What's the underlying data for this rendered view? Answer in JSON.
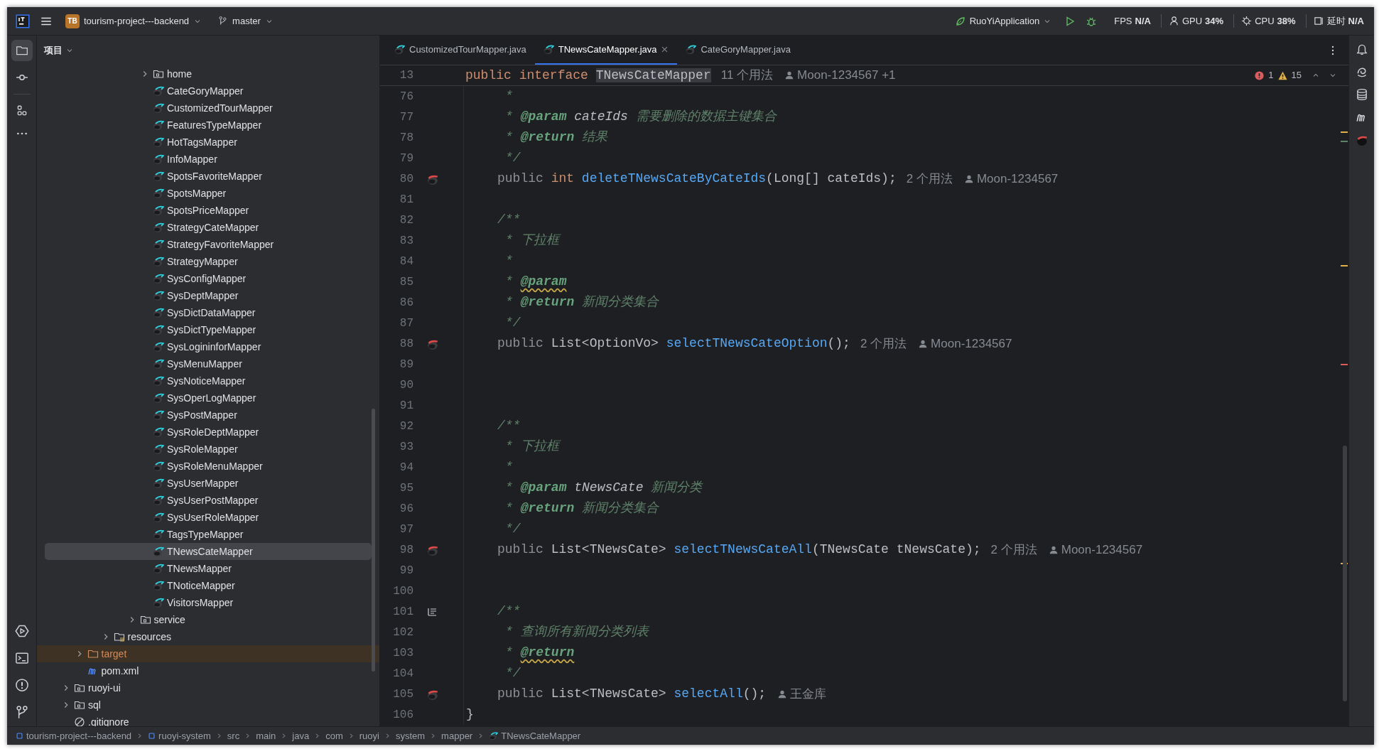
{
  "title_bar": {
    "project_badge": "TB",
    "project": "tourism-project---backend",
    "branch": "master",
    "run_config": "RuoYiApplication",
    "metrics": [
      {
        "kind": "fps",
        "label": "FPS",
        "value": "N/A"
      },
      {
        "kind": "gpu",
        "label": "GPU",
        "value": "34%"
      },
      {
        "kind": "cpu",
        "label": "CPU",
        "value": "38%"
      },
      {
        "kind": "latency",
        "label": "延时",
        "value": "N/A"
      }
    ]
  },
  "project_panel": {
    "title": "项目",
    "tree": [
      {
        "children": [
          {
            "children": [
              {
                "children": [
                  {
                    "children": [
                      {
                        "children": [
                          {
                            "children": [
                              {
                                "label": "home",
                                "kind": "folder",
                                "expanded": false,
                                "selected": false
                              },
                              {
                                "label": "CateGoryMapper",
                                "kind": "mapper",
                                "selected": false
                              },
                              {
                                "label": "CustomizedTourMapper",
                                "kind": "mapper",
                                "selected": false
                              },
                              {
                                "label": "FeaturesTypeMapper",
                                "kind": "mapper",
                                "selected": false
                              },
                              {
                                "label": "HotTagsMapper",
                                "kind": "mapper",
                                "selected": false
                              },
                              {
                                "label": "InfoMapper",
                                "kind": "mapper",
                                "selected": false
                              },
                              {
                                "label": "SpotsFavoriteMapper",
                                "kind": "mapper",
                                "selected": false
                              },
                              {
                                "label": "SpotsMapper",
                                "kind": "mapper",
                                "selected": false
                              },
                              {
                                "label": "SpotsPriceMapper",
                                "kind": "mapper",
                                "selected": false
                              },
                              {
                                "label": "StrategyCateMapper",
                                "kind": "mapper",
                                "selected": false
                              },
                              {
                                "label": "StrategyFavoriteMapper",
                                "kind": "mapper",
                                "selected": false
                              },
                              {
                                "label": "StrategyMapper",
                                "kind": "mapper",
                                "selected": false
                              },
                              {
                                "label": "SysConfigMapper",
                                "kind": "mapper",
                                "selected": false
                              },
                              {
                                "label": "SysDeptMapper",
                                "kind": "mapper",
                                "selected": false
                              },
                              {
                                "label": "SysDictDataMapper",
                                "kind": "mapper",
                                "selected": false
                              },
                              {
                                "label": "SysDictTypeMapper",
                                "kind": "mapper",
                                "selected": false
                              },
                              {
                                "label": "SysLogininforMapper",
                                "kind": "mapper",
                                "selected": false
                              },
                              {
                                "label": "SysMenuMapper",
                                "kind": "mapper",
                                "selected": false
                              },
                              {
                                "label": "SysNoticeMapper",
                                "kind": "mapper",
                                "selected": false
                              },
                              {
                                "label": "SysOperLogMapper",
                                "kind": "mapper",
                                "selected": false
                              },
                              {
                                "label": "SysPostMapper",
                                "kind": "mapper",
                                "selected": false
                              },
                              {
                                "label": "SysRoleDeptMapper",
                                "kind": "mapper",
                                "selected": false
                              },
                              {
                                "label": "SysRoleMapper",
                                "kind": "mapper",
                                "selected": false
                              },
                              {
                                "label": "SysRoleMenuMapper",
                                "kind": "mapper",
                                "selected": false
                              },
                              {
                                "label": "SysUserMapper",
                                "kind": "mapper",
                                "selected": false
                              },
                              {
                                "label": "SysUserPostMapper",
                                "kind": "mapper",
                                "selected": false
                              },
                              {
                                "label": "SysUserRoleMapper",
                                "kind": "mapper",
                                "selected": false
                              },
                              {
                                "label": "TagsTypeMapper",
                                "kind": "mapper",
                                "selected": false
                              },
                              {
                                "label": "TNewsCateMapper",
                                "kind": "mapper",
                                "selected": true
                              },
                              {
                                "label": "TNewsMapper",
                                "kind": "mapper",
                                "selected": false
                              },
                              {
                                "label": "TNoticeMapper",
                                "kind": "mapper",
                                "selected": false
                              },
                              {
                                "label": "VisitorsMapper",
                                "kind": "mapper",
                                "selected": false
                              }
                            ]
                          },
                          {
                            "label": "service",
                            "kind": "folder",
                            "expanded": false,
                            "selected": false
                          }
                        ]
                      }
                    ]
                  },
                  {
                    "label": "resources",
                    "kind": "resources",
                    "expanded": false,
                    "selected": false
                  }
                ]
              }
            ]
          },
          {
            "label": "target",
            "kind": "excluded",
            "expanded": false,
            "selected": false
          },
          {
            "label": "pom.xml",
            "kind": "maven",
            "selected": false
          }
        ]
      },
      {
        "label": "ruoyi-ui",
        "kind": "folder",
        "expanded": false,
        "selected": false
      },
      {
        "label": "sql",
        "kind": "folder",
        "expanded": false,
        "selected": false
      },
      {
        "label": ".gitignore",
        "kind": "ignore",
        "selected": false
      }
    ]
  },
  "editor": {
    "tabs": [
      {
        "label": "CustomizedTourMapper.java",
        "selected": false
      },
      {
        "label": "TNewsCateMapper.java",
        "selected": true
      },
      {
        "label": "CateGoryMapper.java",
        "selected": false
      }
    ],
    "problems": {
      "errors": "1",
      "warnings": "15"
    },
    "sticky_line": {
      "number": "13",
      "tokens": [
        {
          "kind": "keyword",
          "text": "public"
        },
        {
          "kind": "keyword",
          "text": "interface"
        },
        {
          "kind": "highlight",
          "text": "TNewsCateMapper"
        }
      ],
      "usages": "11 个用法",
      "author": "Moon-1234567 +1"
    },
    "lines": [
      {
        "number": "76",
        "kind": "doc",
        "tokens": [
          {
            "kind": "doc",
            "text": "*"
          }
        ]
      },
      {
        "number": "77",
        "kind": "doc",
        "tokens": [
          {
            "kind": "doc",
            "text": "*"
          },
          {
            "kind": "tag",
            "text": "@param",
            "warning": false
          },
          {
            "kind": "docparam",
            "text": "cateIds"
          },
          {
            "kind": "doc",
            "text": "需要删除的数据主键集合"
          }
        ]
      },
      {
        "number": "78",
        "kind": "doc",
        "tokens": [
          {
            "kind": "doc",
            "text": "*"
          },
          {
            "kind": "tag",
            "text": "@return",
            "warning": false
          },
          {
            "kind": "doc",
            "text": "结果"
          }
        ]
      },
      {
        "number": "79",
        "kind": "doc",
        "tokens": [
          {
            "kind": "doc",
            "text": "*/"
          }
        ]
      },
      {
        "number": "80",
        "kind": "member",
        "gutter_icon": {
          "kind": "mapper"
        },
        "tokens": [
          {
            "kind": "modifier",
            "text": "public"
          },
          {
            "kind": "keyword",
            "text": "int"
          },
          {
            "kind": "method",
            "text": "deleteTNewsCateByCateIds"
          },
          {
            "kind": "plain",
            "text": "(Long[] cateIds);",
            "glue": true
          }
        ],
        "usages": "2 个用法",
        "author": "Moon-1234567"
      },
      {
        "number": "81",
        "kind": "blank"
      },
      {
        "number": "82",
        "kind": "member",
        "tokens": [
          {
            "kind": "doc",
            "text": "/**"
          }
        ]
      },
      {
        "number": "83",
        "kind": "doc",
        "tokens": [
          {
            "kind": "doc",
            "text": "*"
          },
          {
            "kind": "doc",
            "text": "下拉框"
          }
        ]
      },
      {
        "number": "84",
        "kind": "doc",
        "tokens": [
          {
            "kind": "doc",
            "text": "*"
          }
        ]
      },
      {
        "number": "85",
        "kind": "doc",
        "tokens": [
          {
            "kind": "doc",
            "text": "*"
          },
          {
            "kind": "tag",
            "text": "@param",
            "warning": true
          }
        ]
      },
      {
        "number": "86",
        "kind": "doc",
        "tokens": [
          {
            "kind": "doc",
            "text": "*"
          },
          {
            "kind": "tag",
            "text": "@return",
            "warning": false
          },
          {
            "kind": "doc",
            "text": "新闻分类集合"
          }
        ]
      },
      {
        "number": "87",
        "kind": "doc",
        "tokens": [
          {
            "kind": "doc",
            "text": "*/"
          }
        ]
      },
      {
        "number": "88",
        "kind": "member",
        "gutter_icon": {
          "kind": "mapper"
        },
        "tokens": [
          {
            "kind": "modifier",
            "text": "public"
          },
          {
            "kind": "plain",
            "text": "List<OptionVo>"
          },
          {
            "kind": "method",
            "text": "selectTNewsCateOption"
          },
          {
            "kind": "plain",
            "text": "();",
            "glue": true
          }
        ],
        "usages": "2 个用法",
        "author": "Moon-1234567"
      },
      {
        "number": "89",
        "kind": "blank"
      },
      {
        "number": "90",
        "kind": "blank"
      },
      {
        "number": "91",
        "kind": "blank"
      },
      {
        "number": "92",
        "kind": "member",
        "tokens": [
          {
            "kind": "doc",
            "text": "/**"
          }
        ]
      },
      {
        "number": "93",
        "kind": "doc",
        "tokens": [
          {
            "kind": "doc",
            "text": "*"
          },
          {
            "kind": "doc",
            "text": "下拉框"
          }
        ]
      },
      {
        "number": "94",
        "kind": "doc",
        "tokens": [
          {
            "kind": "doc",
            "text": "*"
          }
        ]
      },
      {
        "number": "95",
        "kind": "doc",
        "tokens": [
          {
            "kind": "doc",
            "text": "*"
          },
          {
            "kind": "tag",
            "text": "@param",
            "warning": false
          },
          {
            "kind": "docparam",
            "text": "tNewsCate"
          },
          {
            "kind": "doc",
            "text": "新闻分类"
          }
        ]
      },
      {
        "number": "96",
        "kind": "doc",
        "tokens": [
          {
            "kind": "doc",
            "text": "*"
          },
          {
            "kind": "tag",
            "text": "@return",
            "warning": false
          },
          {
            "kind": "doc",
            "text": "新闻分类集合"
          }
        ]
      },
      {
        "number": "97",
        "kind": "doc",
        "tokens": [
          {
            "kind": "doc",
            "text": "*/"
          }
        ]
      },
      {
        "number": "98",
        "kind": "member",
        "gutter_icon": {
          "kind": "mapper"
        },
        "tokens": [
          {
            "kind": "modifier",
            "text": "public"
          },
          {
            "kind": "plain",
            "text": "List<TNewsCate>"
          },
          {
            "kind": "method",
            "text": "selectTNewsCateAll"
          },
          {
            "kind": "plain",
            "text": "(TNewsCate tNewsCate);",
            "glue": true
          }
        ],
        "usages": "2 个用法",
        "author": "Moon-1234567"
      },
      {
        "number": "99",
        "kind": "blank"
      },
      {
        "number": "100",
        "kind": "blank"
      },
      {
        "number": "101",
        "kind": "member",
        "gutter_icon": {
          "kind": "doc"
        },
        "tokens": [
          {
            "kind": "doc",
            "text": "/**"
          }
        ]
      },
      {
        "number": "102",
        "kind": "doc",
        "tokens": [
          {
            "kind": "doc",
            "text": "*"
          },
          {
            "kind": "doc",
            "text": "查询所有新闻分类列表"
          }
        ]
      },
      {
        "number": "103",
        "kind": "doc",
        "tokens": [
          {
            "kind": "doc",
            "text": "*"
          },
          {
            "kind": "tag",
            "text": "@return",
            "warning": true
          }
        ]
      },
      {
        "number": "104",
        "kind": "doc",
        "tokens": [
          {
            "kind": "doc",
            "text": "*/"
          }
        ]
      },
      {
        "number": "105",
        "kind": "member",
        "gutter_icon": {
          "kind": "mapper"
        },
        "tokens": [
          {
            "kind": "modifier",
            "text": "public"
          },
          {
            "kind": "plain",
            "text": "List<TNewsCate>"
          },
          {
            "kind": "method",
            "text": "selectAll"
          },
          {
            "kind": "plain",
            "text": "();",
            "glue": true
          }
        ],
        "author": "王金库"
      },
      {
        "number": "106",
        "kind": "closing",
        "tokens": [
          {
            "kind": "plain",
            "text": "}"
          }
        ]
      }
    ]
  },
  "status_bar": {
    "breadcrumbs": [
      {
        "kind": "module",
        "text": "tourism-project---backend"
      },
      {
        "kind": "module",
        "text": "ruoyi-system"
      },
      {
        "kind": "dir",
        "text": "src"
      },
      {
        "kind": "dir",
        "text": "main"
      },
      {
        "kind": "dir",
        "text": "java"
      },
      {
        "kind": "dir",
        "text": "com"
      },
      {
        "kind": "dir",
        "text": "ruoyi"
      },
      {
        "kind": "dir",
        "text": "system"
      },
      {
        "kind": "dir",
        "text": "mapper"
      },
      {
        "kind": "mapper",
        "text": "TNewsCateMapper"
      }
    ]
  }
}
